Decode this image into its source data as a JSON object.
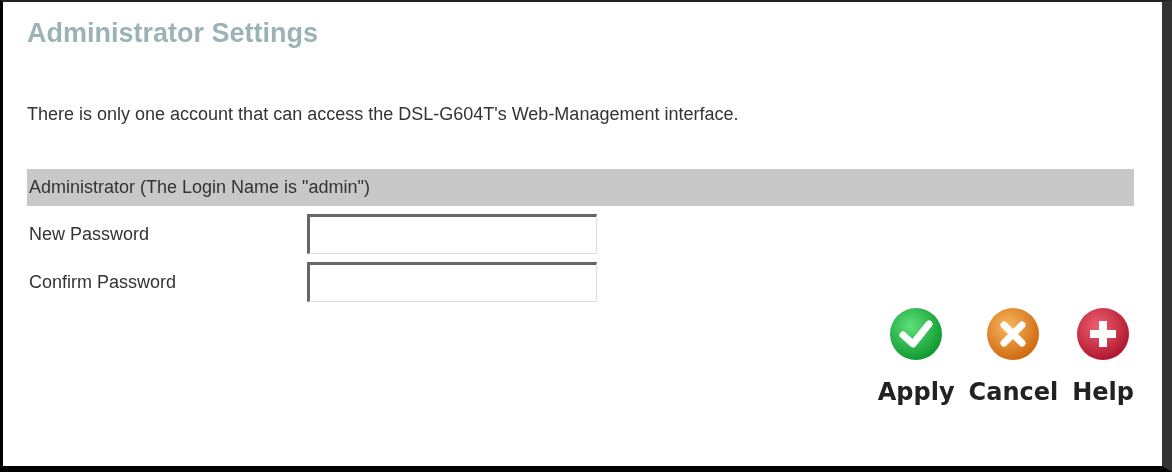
{
  "title": "Administrator Settings",
  "description": "There is only one account that can access the DSL-G604T's Web-Management interface.",
  "section": {
    "heading": "Administrator (The Login Name is \"admin\")"
  },
  "fields": [
    {
      "label": "New Password"
    },
    {
      "label": "Confirm Password"
    }
  ],
  "buttons": [
    {
      "kind": "apply",
      "label": "Apply"
    },
    {
      "kind": "cancel",
      "label": "Cancel"
    },
    {
      "kind": "help",
      "label": "Help"
    }
  ]
}
